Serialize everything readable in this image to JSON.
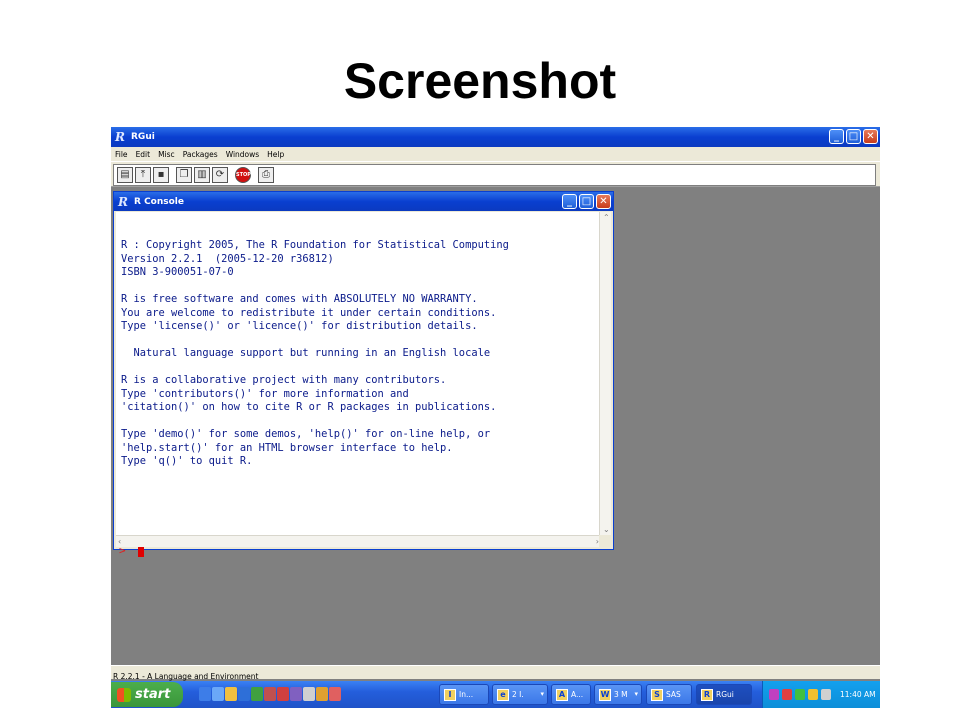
{
  "slide": {
    "title": "Screenshot"
  },
  "rgui": {
    "title": "RGui",
    "window_buttons": {
      "minimize": "_",
      "maximize": "□",
      "close": "✕"
    },
    "menu": [
      "File",
      "Edit",
      "Misc",
      "Packages",
      "Windows",
      "Help"
    ],
    "toolbar": [
      {
        "icon": "open-script-icon",
        "glyph": "▤"
      },
      {
        "icon": "load-workspace-icon",
        "glyph": "⤒"
      },
      {
        "icon": "save-workspace-icon",
        "glyph": "▪"
      },
      {
        "icon": "copy-icon",
        "glyph": "❐"
      },
      {
        "icon": "paste-icon",
        "glyph": "▥"
      },
      {
        "icon": "copy-paste-icon",
        "glyph": "⟳"
      },
      {
        "icon": "stop-icon",
        "glyph": "STOP"
      },
      {
        "icon": "print-icon",
        "glyph": "⎙"
      }
    ],
    "status": "R 2.2.1 - A Language and Environment"
  },
  "console": {
    "title": "R Console",
    "lines": [
      "R : Copyright 2005, The R Foundation for Statistical Computing",
      "Version 2.2.1  (2005-12-20 r36812)",
      "ISBN 3-900051-07-0",
      "",
      "R is free software and comes with ABSOLUTELY NO WARRANTY.",
      "You are welcome to redistribute it under certain conditions.",
      "Type 'license()' or 'licence()' for distribution details.",
      "",
      "  Natural language support but running in an English locale",
      "",
      "R is a collaborative project with many contributors.",
      "Type 'contributors()' for more information and",
      "'citation()' on how to cite R or R packages in publications.",
      "",
      "Type 'demo()' for some demos, 'help()' for on-line help, or",
      "'help.start()' for an HTML browser interface to help.",
      "Type 'q()' to quit R."
    ],
    "prompt": ">"
  },
  "taskbar": {
    "start_label": "start",
    "quick_launch_colors": [
      "#3d7de8",
      "#6aa8f8",
      "#f0c040",
      "#2e6fd8",
      "#40a040",
      "#c05050",
      "#d04040",
      "#8060c0",
      "#d0d0d0",
      "#e0a030",
      "#e06060"
    ],
    "tasks": [
      {
        "label": "In...",
        "icon": "I",
        "dropdown": false
      },
      {
        "label": "2 I.",
        "icon": "e",
        "dropdown": true
      },
      {
        "label": "A...",
        "icon": "A",
        "dropdown": false
      },
      {
        "label": "3 M",
        "icon": "W",
        "dropdown": true
      },
      {
        "label": "SAS",
        "icon": "S",
        "dropdown": false
      },
      {
        "label": "RGui",
        "icon": "R",
        "dropdown": false,
        "active": true
      }
    ],
    "tray_colors": [
      "#c040c0",
      "#e04040",
      "#40c040",
      "#f0c030",
      "#d0d0d0"
    ],
    "clock": "11:40 AM"
  }
}
